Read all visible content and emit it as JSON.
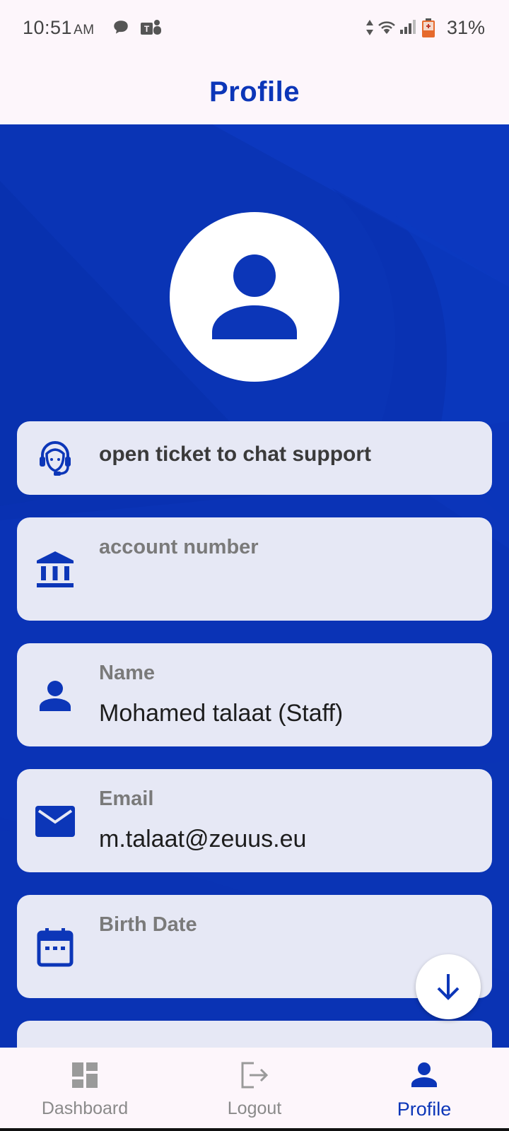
{
  "status_bar": {
    "time": "10:51",
    "ampm": "AM",
    "battery_percent": "31%",
    "icons": [
      "chat-bubble-icon",
      "teams-icon",
      "data-arrows-icon",
      "wifi-icon",
      "signal-icon",
      "battery-icon"
    ]
  },
  "header": {
    "title": "Profile"
  },
  "colors": {
    "primary": "#0c36b8",
    "background": "#0a34b5",
    "card": "#e6e8f5"
  },
  "cards": {
    "support": {
      "label": "open ticket to chat support",
      "icon": "headset-agent-icon"
    },
    "account": {
      "label": "account number",
      "value": "",
      "icon": "bank-icon"
    },
    "name": {
      "label": "Name",
      "value": "Mohamed talaat  (Staff)",
      "icon": "person-icon"
    },
    "email": {
      "label": "Email",
      "value": "m.talaat@zeuus.eu",
      "icon": "mail-icon"
    },
    "birth": {
      "label": "Birth Date",
      "value": "",
      "icon": "calendar-icon"
    }
  },
  "fab": {
    "icon": "arrow-down-icon"
  },
  "nav": {
    "items": [
      {
        "label": "Dashboard",
        "icon": "dashboard-icon",
        "active": false
      },
      {
        "label": "Logout",
        "icon": "logout-icon",
        "active": false
      },
      {
        "label": "Profile",
        "icon": "person-icon",
        "active": true
      }
    ]
  }
}
